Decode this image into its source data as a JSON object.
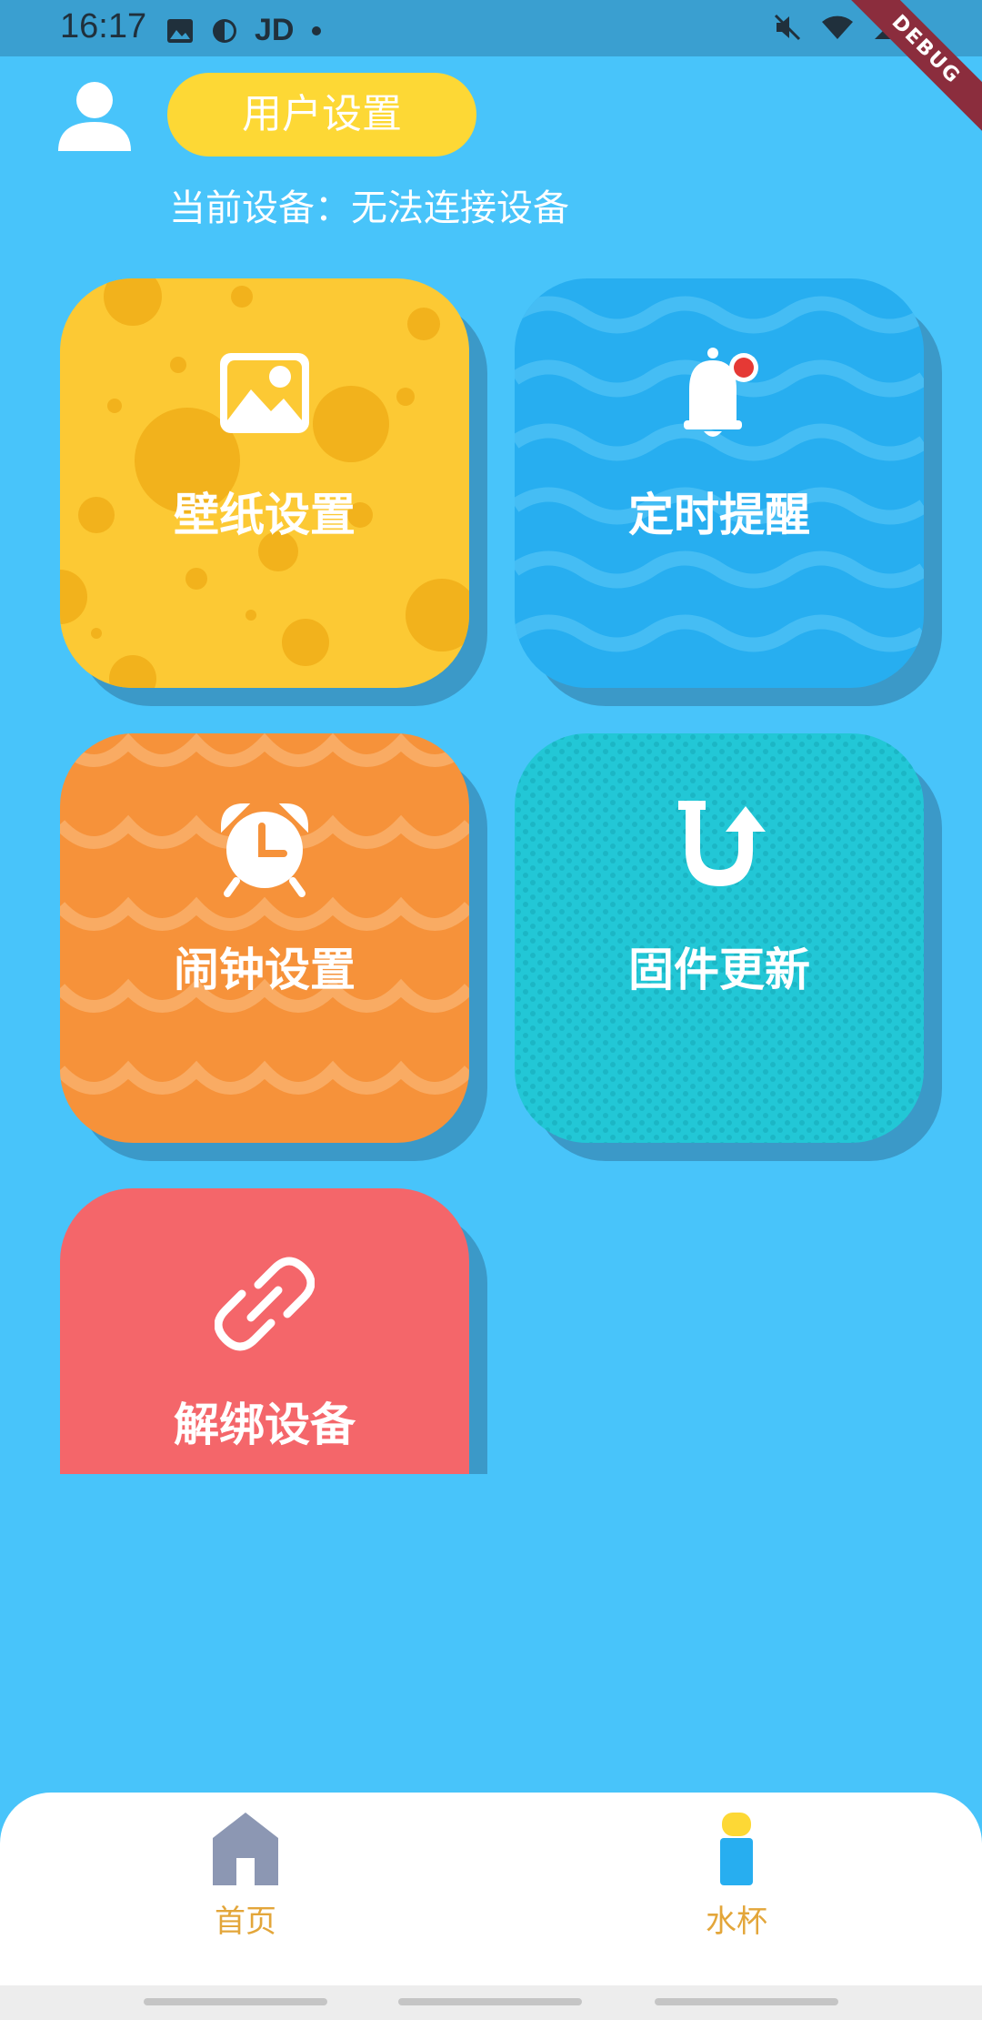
{
  "status_bar": {
    "time": "16:17",
    "carrier": "JD",
    "debug_ribbon": "DEBUG",
    "left_icons": [
      "image-icon",
      "shield-icon",
      "dot-icon"
    ],
    "right_icons": [
      "mute-icon",
      "wifi-icon",
      "signal-icon",
      "battery-icon"
    ]
  },
  "header": {
    "user_settings_label": "用户设置",
    "device_status": "当前设备：无法连接设备",
    "avatar_icon": "user-icon"
  },
  "cards": [
    {
      "label": "壁纸设置",
      "icon": "image-icon",
      "color": "#fcc934",
      "pattern": "cheese"
    },
    {
      "label": "定时提醒",
      "icon": "bell-icon",
      "color": "#27aef0",
      "pattern": "waves"
    },
    {
      "label": "闹钟设置",
      "icon": "alarm-clock-icon",
      "color": "#f6923a",
      "pattern": "scallops"
    },
    {
      "label": "固件更新",
      "icon": "u-turn-arrow-icon",
      "color": "#22c7d6",
      "pattern": "dots"
    },
    {
      "label": "解绑设备",
      "icon": "unlink-icon",
      "color": "#f4666a",
      "pattern": "plain"
    }
  ],
  "bottom_nav": {
    "items": [
      {
        "label": "首页",
        "icon": "home-icon"
      },
      {
        "label": "水杯",
        "icon": "water-cup-icon"
      }
    ],
    "label_color": "#e3a63a"
  },
  "colors": {
    "background": "#48c4fa",
    "accent_yellow": "#fdd835",
    "status_bar": "#3a9fd0"
  }
}
